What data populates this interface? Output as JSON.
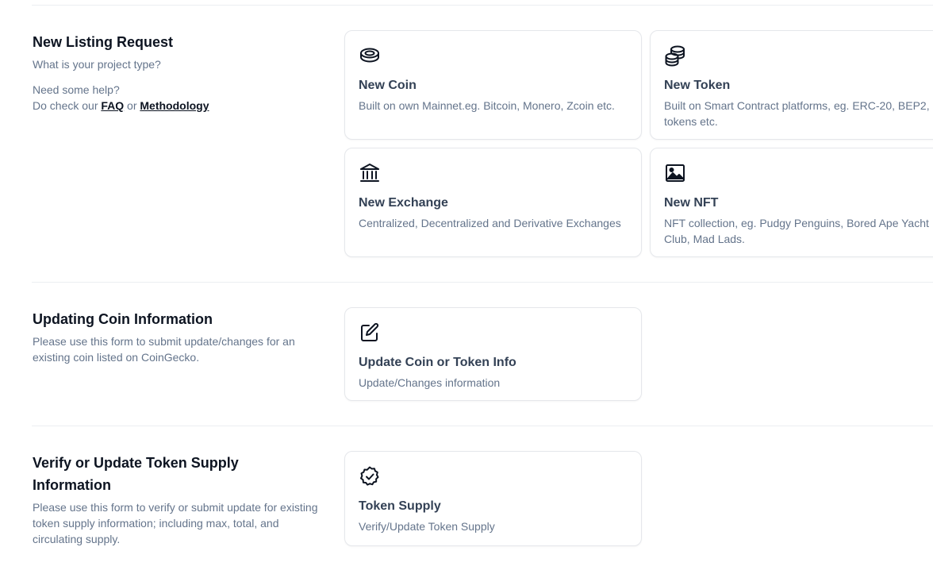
{
  "listing": {
    "title": "New Listing Request",
    "subtitle": "What is your project type?",
    "help_line1": "Need some help?",
    "help_prefix": "Do check our ",
    "faq_link": "FAQ",
    "help_or": " or ",
    "methodology_link": "Methodology",
    "cards": [
      {
        "title": "New Coin",
        "desc": "Built on own Mainnet.eg. Bitcoin, Monero, Zcoin etc.",
        "icon": "coin-icon"
      },
      {
        "title": "New Token",
        "desc": "Built on Smart Contract platforms, eg. ERC-20, BEP2, tokens etc.",
        "icon": "coins-stack-icon"
      },
      {
        "title": "New Exchange",
        "desc": "Centralized, Decentralized and Derivative Exchanges",
        "icon": "bank-icon"
      },
      {
        "title": "New NFT",
        "desc": "NFT collection, eg. Pudgy Penguins, Bored Ape Yacht Club, Mad Lads.",
        "icon": "image-icon"
      }
    ]
  },
  "update": {
    "title": "Updating Coin Information",
    "subtitle": "Please use this form to submit update/changes for an existing coin listed on CoinGecko.",
    "card": {
      "title": "Update Coin or Token Info",
      "desc": "Update/Changes information",
      "icon": "edit-icon"
    }
  },
  "supply": {
    "title": "Verify or Update Token Supply Information",
    "subtitle": "Please use this form to verify or submit update for existing token supply information; including max, total, and circulating supply.",
    "card": {
      "title": "Token Supply",
      "desc": "Verify/Update Token Supply",
      "icon": "verified-badge-icon"
    }
  },
  "colors": {
    "heading": "#0d1421",
    "muted": "#64748b",
    "card_title": "#334155",
    "border": "#e5e7eb"
  }
}
